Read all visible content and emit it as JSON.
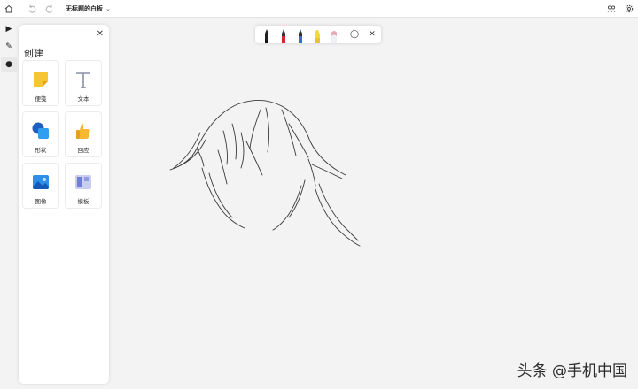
{
  "topbar": {
    "title": "无标题的白板",
    "home_icon": "home-icon",
    "undo_icon": "undo-icon",
    "redo_icon": "redo-icon",
    "chevron_icon": "chevron-down-icon",
    "share_icon": "share-icon",
    "settings_icon": "gear-icon"
  },
  "rail": {
    "items": [
      {
        "name": "select-tool",
        "icon": "cursor-icon",
        "glyph": "▶"
      },
      {
        "name": "pen-tool",
        "icon": "pen-icon",
        "glyph": "✎"
      },
      {
        "name": "create-tool",
        "icon": "plus-circle-icon",
        "glyph": "●"
      }
    ]
  },
  "panel": {
    "title": "创建",
    "close_glyph": "✕",
    "items": [
      {
        "label": "便笺",
        "icon": "sticky-note-icon"
      },
      {
        "label": "文本",
        "icon": "text-icon"
      },
      {
        "label": "形状",
        "icon": "shapes-icon"
      },
      {
        "label": "回应",
        "icon": "reaction-icon"
      },
      {
        "label": "图像",
        "icon": "image-icon"
      },
      {
        "label": "模板",
        "icon": "template-icon"
      }
    ]
  },
  "pentools": {
    "pens": [
      {
        "name": "pen-black",
        "color": "#222222"
      },
      {
        "name": "pen-red",
        "color": "#d6262f"
      },
      {
        "name": "pen-blue",
        "color": "#2f6fd6"
      },
      {
        "name": "highlighter-yellow",
        "color": "#f2d83a"
      },
      {
        "name": "eraser",
        "color": "#e8a9b3"
      }
    ],
    "lasso_glyph": "◯",
    "close_glyph": "✕"
  },
  "colors": {
    "accent_yellow": "#f7c432",
    "accent_blue": "#1e7be0"
  },
  "watermark": "头条 @手机中国"
}
